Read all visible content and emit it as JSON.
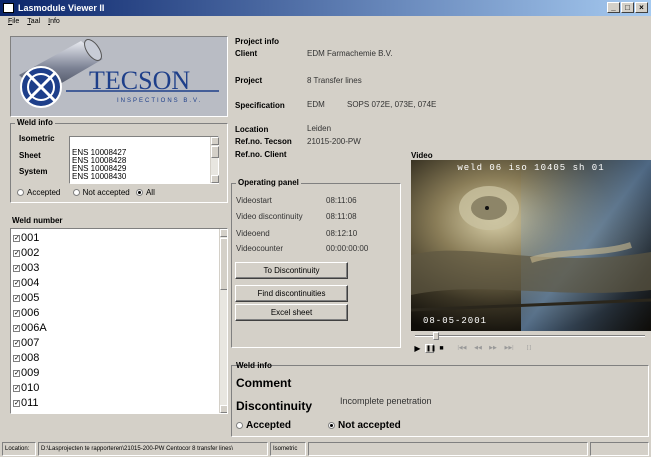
{
  "window": {
    "title": "Lasmodule Viewer II",
    "btn_min": "_",
    "btn_max": "□",
    "btn_close": "×"
  },
  "menu": [
    "File",
    "Taal",
    "Info"
  ],
  "logo": {
    "name": "TECSON",
    "tagline": "INSPECTIONS B.V."
  },
  "weld_info_left": {
    "title": "Weld info",
    "isometric_label": "Isometric",
    "sheet_label": "Sheet",
    "system_label": "System",
    "isometrics": [
      "ENS 10008427",
      "ENS 10008428",
      "ENS 10008429",
      "ENS 10008430"
    ],
    "filter": {
      "accepted": "Accepted",
      "not_accepted": "Not accepted",
      "all": "All",
      "selected": "All"
    }
  },
  "weld_number": {
    "title": "Weld number",
    "items": [
      "001",
      "002",
      "003",
      "004",
      "005",
      "006",
      "006A",
      "007",
      "008",
      "009",
      "010",
      "011"
    ]
  },
  "project_info": {
    "title": "Project info",
    "client_label": "Client",
    "client": "EDM Farmachemie B.V.",
    "project_label": "Project",
    "project": "8 Transfer lines",
    "specification_label": "Specification",
    "specification_a": "EDM",
    "specification_b": "SOPS 072E, 073E, 074E",
    "location_label": "Location",
    "location": "Leiden",
    "ref_tecson_label": "Ref.no. Tecson",
    "ref_tecson": "21015-200-PW",
    "ref_client_label": "Ref.no. Client",
    "ref_client": ""
  },
  "operating_panel": {
    "title": "Operating panel",
    "rows": [
      {
        "label": "Videostart",
        "value": "08:11:06"
      },
      {
        "label": "Video discontinuity",
        "value": "08:11:08"
      },
      {
        "label": "Videoend",
        "value": "08:12:10"
      },
      {
        "label": "Videocounter",
        "value": "00:00:00:00"
      }
    ],
    "btn_to_discontinuity": "To Discontinuity",
    "btn_find": "Find discontinuities",
    "btn_excel": "Excel sheet"
  },
  "video": {
    "title": "Video",
    "overlay_top": "weld 06 iso 10405 sh 01",
    "overlay_date": "08-05-2001",
    "controls": {
      "play": "▶",
      "pause": "❚❚",
      "stop": "■",
      "first": "|◀◀",
      "rewind": "◀◀",
      "forward": "▶▶",
      "last": "▶▶|",
      "snapshot": "[ ]"
    }
  },
  "weld_info_bottom": {
    "title": "Weld info",
    "comment_label": "Comment",
    "comment": "",
    "discontinuity_label": "Discontinuity",
    "discontinuity": "Incomplete penetration",
    "accepted": "Accepted",
    "not_accepted": "Not accepted",
    "selected": "Not accepted"
  },
  "status": {
    "location_label": "Location:",
    "location_path": "D:\\Lasprojecten te rapporteren\\21015-200-PW Centocor 8 transfer lines\\",
    "mode": "Isometric"
  },
  "colors": {
    "face": "#d4d0c8",
    "title_start": "#0a246a",
    "title_end": "#a6caf0",
    "logo_blue": "#1e3f8a"
  }
}
